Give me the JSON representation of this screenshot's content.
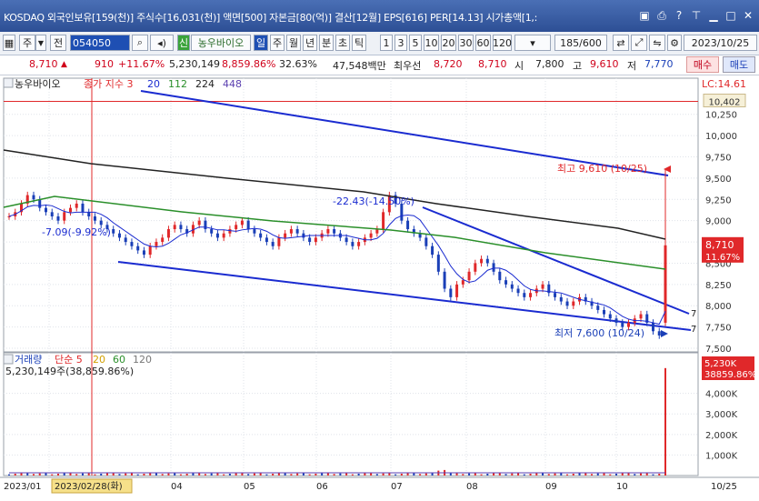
{
  "window": {
    "title": "KOSDAQ 외국인보유[159(천)] 주식수[16,031(천)] 액면[500] 자본금[80(억)] 결산[12월] EPS[616] PER[14.13] 시가총액[1,:"
  },
  "toolbar": {
    "mode1": "주",
    "mode2": "전",
    "code": "054050",
    "stock_name": "농우바이오",
    "periods": [
      "일",
      "주",
      "월",
      "년",
      "분",
      "초",
      "틱"
    ],
    "nums": [
      "1",
      "3",
      "5",
      "10",
      "20",
      "30",
      "60",
      "120"
    ],
    "count": "185",
    "total": "/600",
    "date": "2023/10/25"
  },
  "info": {
    "price": "8,710",
    "change": "910",
    "change_pct": "+11.67%",
    "volume": "5,230,149",
    "vol_pct": "8,859.86%",
    "turnover": "32.63%",
    "amount": "47,548백만",
    "best_sell_label": "최우선",
    "best_sell": "8,720",
    "best_buy": "8,710",
    "open_label": "시",
    "open": "7,800",
    "high_label": "고",
    "high": "9,610",
    "low_label": "저",
    "low": "7,770",
    "buy_btn": "매수",
    "sell_btn": "매도"
  },
  "chart_panel": {
    "name": "농우바이오",
    "legend_title": "종가 지수 3",
    "ma": [
      "20",
      "112",
      "224",
      "448"
    ],
    "ma_colors": [
      "#1a2bd0",
      "#2a8f2a",
      "#222222",
      "#5a3fb0"
    ],
    "lc_label": "LC:14.61",
    "ref_line_label": "10,402",
    "last_price_label": "8,710",
    "last_pct_label": "11.67%",
    "high_annot": "최고 9,610 (10/25)",
    "low_annot": "최저 7,600 (10/24)",
    "trend_annot_1": "-22.43(-14.50%)",
    "trend_annot_2": "-7.09(-9.92%)",
    "right_edge_7a": "7",
    "right_edge_7b": "7"
  },
  "volume_panel": {
    "legend_title": "거래량",
    "legend_ma": "단순 5",
    "ma": [
      "20",
      "60",
      "120"
    ],
    "ma_colors": [
      "#d2a000",
      "#2a8f2a",
      "#777777"
    ],
    "summary": "5,230,149주(38,859.86%)",
    "last_label": "5,230K",
    "last_pct": "38859.86%"
  },
  "x_axis": {
    "labels": [
      "2023/01",
      "04",
      "05",
      "06",
      "07",
      "08",
      "09",
      "10",
      "10/25"
    ],
    "cursor_label": "2023/02/28(화)"
  },
  "chart_data": {
    "type": "line",
    "title": "",
    "price_axis": {
      "ylim": [
        7500,
        10600
      ],
      "ticks": [
        10250,
        10000,
        9750,
        9500,
        9250,
        9000,
        8750,
        8500,
        8250,
        8000,
        7750,
        7500
      ],
      "tick_labels": [
        "10,250",
        "10,000",
        "9,750",
        "9,500",
        "9,250",
        "9,000",
        "8,750",
        "8,500",
        "8,250",
        "8,000",
        "7,750",
        "7,500"
      ]
    },
    "volume_axis": {
      "ylim": [
        0,
        5400000
      ],
      "ticks": [
        1000000,
        2000000,
        3000000,
        4000000
      ],
      "tick_labels": [
        "1,000K",
        "2,000K",
        "3,000K",
        "4,000K"
      ]
    },
    "reference_line": 10402,
    "close_series": [
      9050,
      9100,
      9200,
      9300,
      9250,
      9150,
      9100,
      9050,
      9000,
      9100,
      9150,
      9200,
      9100,
      9050,
      9000,
      8950,
      8900,
      8850,
      8800,
      8750,
      8700,
      8650,
      8600,
      8700,
      8750,
      8800,
      8900,
      8950,
      8900,
      8850,
      8950,
      9000,
      8900,
      8850,
      8800,
      8850,
      8900,
      8950,
      9000,
      8900,
      8850,
      8800,
      8750,
      8700,
      8800,
      8850,
      8900,
      8850,
      8800,
      8750,
      8800,
      8850,
      8900,
      8850,
      8800,
      8750,
      8700,
      8750,
      8800,
      8850,
      8900,
      9100,
      9300,
      9200,
      9000,
      8900,
      8850,
      8800,
      8700,
      8600,
      8400,
      8200,
      8100,
      8250,
      8300,
      8400,
      8500,
      8550,
      8500,
      8400,
      8300,
      8250,
      8200,
      8150,
      8100,
      8150,
      8200,
      8250,
      8150,
      8100,
      8050,
      8000,
      8050,
      8100,
      8050,
      8000,
      7950,
      7900,
      7850,
      7800,
      7750,
      7800,
      7850,
      7900,
      7800,
      7700,
      7650,
      8710
    ],
    "series": [
      {
        "name": "20",
        "color": "#1a2bd0"
      },
      {
        "name": "112",
        "color": "#2a8f2a"
      },
      {
        "name": "224",
        "color": "#222222"
      }
    ],
    "volume_last": 5230149,
    "high": {
      "value": 9610,
      "date": "10/25"
    },
    "low": {
      "value": 7600,
      "date": "10/24"
    }
  }
}
